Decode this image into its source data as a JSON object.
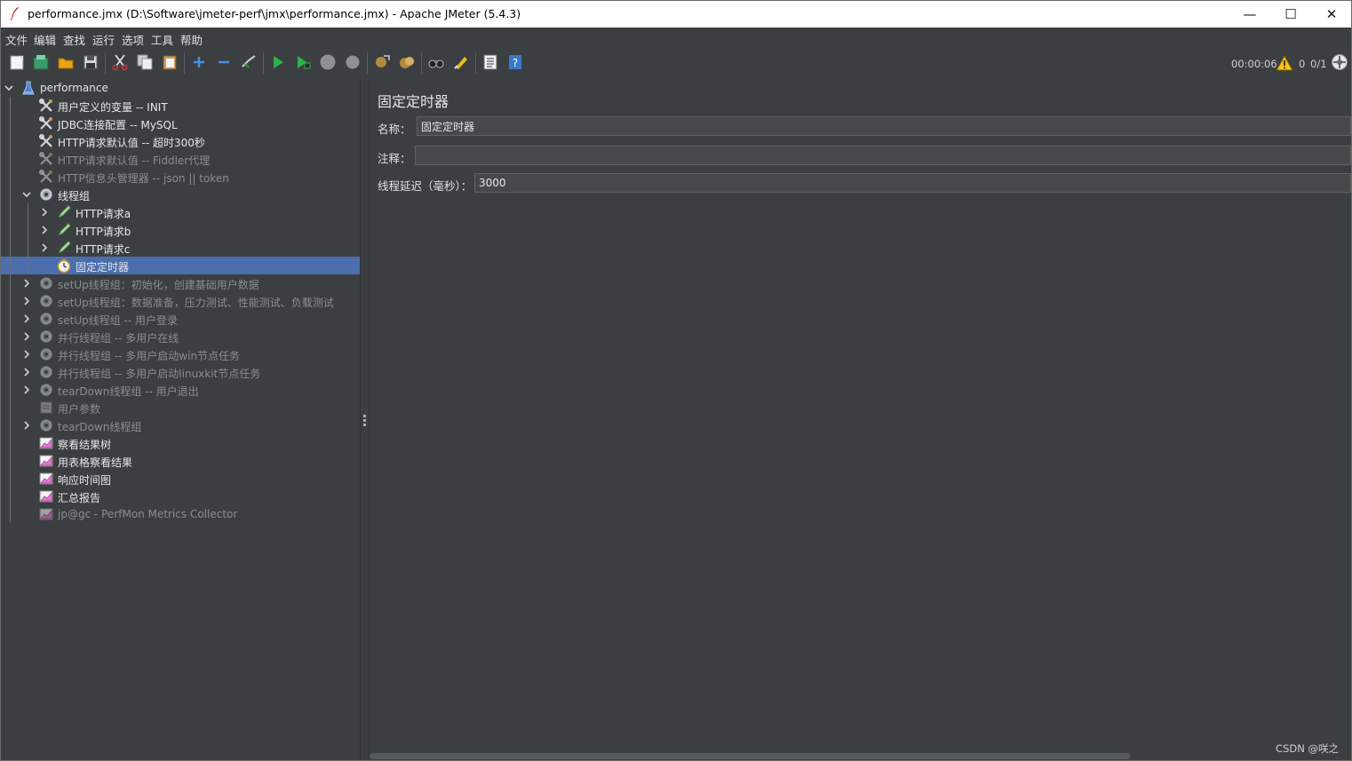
{
  "window": {
    "title": "performance.jmx (D:\\Software\\jmeter-perf\\jmx\\performance.jmx) - Apache JMeter (5.4.3)",
    "minimize": "—",
    "maximize": "☐",
    "close": "✕"
  },
  "menu": [
    "文件",
    "编辑",
    "查找",
    "运行",
    "选项",
    "工具",
    "帮助"
  ],
  "toolbar": {
    "elapsed": "00:00:06",
    "warnings": "0",
    "threads": "0/1"
  },
  "tree": [
    {
      "label": "performance",
      "icon": "flask-icon",
      "depth": 0,
      "expander": "open",
      "disabled": false
    },
    {
      "label": "用户定义的变量 -- INIT",
      "icon": "config-wrench-icon",
      "depth": 1,
      "expander": "none",
      "disabled": false
    },
    {
      "label": "JDBC连接配置 -- MySQL",
      "icon": "config-wrench-icon",
      "depth": 1,
      "expander": "none",
      "disabled": false
    },
    {
      "label": "HTTP请求默认值 -- 超时300秒",
      "icon": "config-wrench-icon",
      "depth": 1,
      "expander": "none",
      "disabled": false
    },
    {
      "label": "HTTP请求默认值 -- Fiddler代理",
      "icon": "config-wrench-icon",
      "depth": 1,
      "expander": "none",
      "disabled": true
    },
    {
      "label": "HTTP信息头管理器 -- json || token",
      "icon": "config-wrench-icon",
      "depth": 1,
      "expander": "none",
      "disabled": true
    },
    {
      "label": "线程组",
      "icon": "gear-icon",
      "depth": 1,
      "expander": "open",
      "disabled": false
    },
    {
      "label": "HTTP请求a",
      "icon": "pipette-icon",
      "depth": 2,
      "expander": "closed",
      "disabled": false
    },
    {
      "label": "HTTP请求b",
      "icon": "pipette-icon",
      "depth": 2,
      "expander": "closed",
      "disabled": false
    },
    {
      "label": "HTTP请求c",
      "icon": "pipette-icon",
      "depth": 2,
      "expander": "closed",
      "disabled": false
    },
    {
      "label": "固定定时器",
      "icon": "stopwatch-icon",
      "depth": 2,
      "expander": "none",
      "disabled": false,
      "selected": true
    },
    {
      "label": "setUp线程组：初始化，创建基础用户数据",
      "icon": "gear-icon",
      "depth": 1,
      "expander": "closed",
      "disabled": true
    },
    {
      "label": "setUp线程组：数据准备，压力测试、性能测试、负载测试",
      "icon": "gear-icon",
      "depth": 1,
      "expander": "closed",
      "disabled": true
    },
    {
      "label": "setUp线程组 -- 用户登录",
      "icon": "gear-icon",
      "depth": 1,
      "expander": "closed",
      "disabled": true
    },
    {
      "label": "并行线程组 -- 多用户在线",
      "icon": "gear-icon",
      "depth": 1,
      "expander": "closed",
      "disabled": true
    },
    {
      "label": "并行线程组 -- 多用户启动win节点任务",
      "icon": "gear-icon",
      "depth": 1,
      "expander": "closed",
      "disabled": true
    },
    {
      "label": "并行线程组 -- 多用户启动linuxkit节点任务",
      "icon": "gear-icon",
      "depth": 1,
      "expander": "closed",
      "disabled": true
    },
    {
      "label": "tearDown线程组 -- 用户退出",
      "icon": "gear-icon",
      "depth": 1,
      "expander": "closed",
      "disabled": true
    },
    {
      "label": "用户参数",
      "icon": "params-icon",
      "depth": 1,
      "expander": "none",
      "disabled": true
    },
    {
      "label": "tearDown线程组",
      "icon": "gear-icon",
      "depth": 1,
      "expander": "closed",
      "disabled": true
    },
    {
      "label": "察看结果树",
      "icon": "graph-icon",
      "depth": 1,
      "expander": "none",
      "disabled": false
    },
    {
      "label": "用表格察看结果",
      "icon": "graph-icon",
      "depth": 1,
      "expander": "none",
      "disabled": false
    },
    {
      "label": "响应时间图",
      "icon": "graph-icon",
      "depth": 1,
      "expander": "none",
      "disabled": false
    },
    {
      "label": "汇总报告",
      "icon": "graph-icon",
      "depth": 1,
      "expander": "none",
      "disabled": false
    },
    {
      "label": "jp@gc - PerfMon Metrics Collector",
      "icon": "graph-icon",
      "depth": 1,
      "expander": "none",
      "disabled": true
    }
  ],
  "panel": {
    "title": "固定定时器",
    "name_label": "名称：",
    "name_value": "固定定时器",
    "comment_label": "注释：",
    "comment_value": "",
    "delay_label": "线程延迟（毫秒）：",
    "delay_value": "3000"
  },
  "watermark": "CSDN @咲之"
}
